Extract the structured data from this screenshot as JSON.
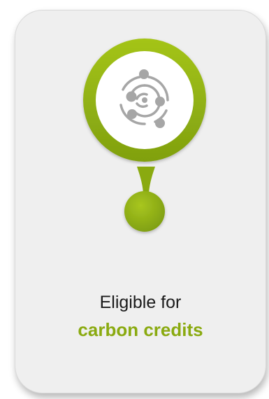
{
  "card": {
    "line1": "Eligible for",
    "line2": "carbon credits"
  },
  "icon": {
    "name": "orbit-atom-icon"
  },
  "colors": {
    "accent": "#8aaa10",
    "accent_light": "#a7c616",
    "icon_gray": "#a6a6a6",
    "card_bg": "#efefef",
    "text": "#1a1a1a"
  }
}
